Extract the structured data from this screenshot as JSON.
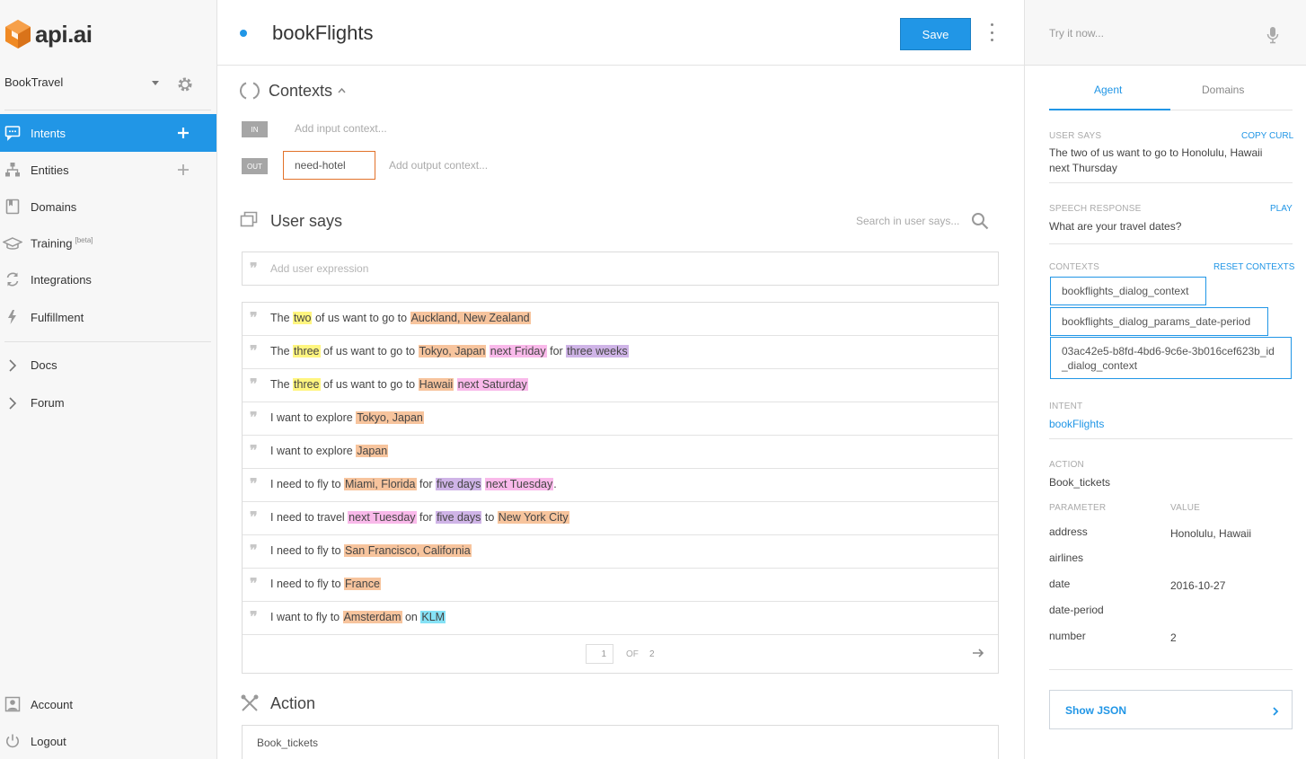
{
  "logo": {
    "text": "api.ai",
    "icon": "cube-logo-icon",
    "color": "#f08a24"
  },
  "agent": {
    "name": "BookTravel"
  },
  "sidebar": {
    "items": [
      {
        "label": "Intents",
        "icon": "chat-icon",
        "active": true,
        "plus": true
      },
      {
        "label": "Entities",
        "icon": "hierarchy-icon",
        "plus": true
      },
      {
        "label": "Domains",
        "icon": "book-icon"
      },
      {
        "label": "Training",
        "sup": "[beta]",
        "icon": "graduation-cap-icon"
      },
      {
        "label": "Integrations",
        "icon": "refresh-icon"
      },
      {
        "label": "Fulfillment",
        "icon": "lightning-icon"
      },
      {
        "label": "Docs",
        "icon": "chevron-right-icon"
      },
      {
        "label": "Forum",
        "icon": "chevron-right-icon"
      }
    ],
    "bottom": [
      {
        "label": "Account",
        "icon": "account-icon"
      },
      {
        "label": "Logout",
        "icon": "power-icon"
      }
    ]
  },
  "intent": {
    "title": "bookFlights",
    "save_label": "Save"
  },
  "contexts": {
    "title": "Contexts",
    "in_tag": "IN",
    "out_tag": "OUT",
    "input_placeholder": "Add input context...",
    "output_chip": "need-hotel",
    "output_placeholder": "Add output context..."
  },
  "user_says": {
    "title": "User says",
    "search_placeholder": "Search in user says...",
    "add_placeholder": "Add user expression",
    "examples": [
      [
        {
          "t": "The "
        },
        {
          "t": "two",
          "c": "num"
        },
        {
          "t": " of us want to go to "
        },
        {
          "t": "Auckland, New Zealand",
          "c": "geo"
        }
      ],
      [
        {
          "t": "The "
        },
        {
          "t": "three",
          "c": "num"
        },
        {
          "t": " of us want to go to "
        },
        {
          "t": "Tokyo, Japan",
          "c": "geo"
        },
        {
          "t": " "
        },
        {
          "t": "next Friday",
          "c": "date"
        },
        {
          "t": " for "
        },
        {
          "t": "three weeks",
          "c": "dur"
        }
      ],
      [
        {
          "t": "The "
        },
        {
          "t": "three",
          "c": "num"
        },
        {
          "t": " of us want to go to "
        },
        {
          "t": "Hawaii",
          "c": "geo"
        },
        {
          "t": " "
        },
        {
          "t": "next Saturday",
          "c": "date"
        }
      ],
      [
        {
          "t": "I want to explore "
        },
        {
          "t": "Tokyo, Japan",
          "c": "geo"
        }
      ],
      [
        {
          "t": "I want to explore "
        },
        {
          "t": "Japan",
          "c": "geo"
        }
      ],
      [
        {
          "t": "I need to fly to "
        },
        {
          "t": "Miami, Florida",
          "c": "geo"
        },
        {
          "t": " for "
        },
        {
          "t": "five days",
          "c": "dur"
        },
        {
          "t": " "
        },
        {
          "t": "next Tuesday",
          "c": "date"
        },
        {
          "t": "."
        }
      ],
      [
        {
          "t": "I need to travel "
        },
        {
          "t": "next Tuesday",
          "c": "date"
        },
        {
          "t": " for "
        },
        {
          "t": "five days",
          "c": "dur"
        },
        {
          "t": " to "
        },
        {
          "t": "New York City",
          "c": "geo"
        }
      ],
      [
        {
          "t": "I need to fly to "
        },
        {
          "t": "San Francisco, California",
          "c": "geo"
        }
      ],
      [
        {
          "t": "I need to fly to "
        },
        {
          "t": "France",
          "c": "geo"
        }
      ],
      [
        {
          "t": "I want to fly to "
        },
        {
          "t": "Amsterdam",
          "c": "geo"
        },
        {
          "t": " on "
        },
        {
          "t": "KLM",
          "c": "air"
        }
      ]
    ],
    "pager": {
      "page": "1",
      "of": "OF",
      "total": "2"
    }
  },
  "action": {
    "title": "Action",
    "value": "Book_tickets"
  },
  "console": {
    "try_placeholder": "Try it now...",
    "tabs": [
      "Agent",
      "Domains"
    ],
    "user_says_label": "USER SAYS",
    "copy_curl": "COPY CURL",
    "user_says_value": "The two of us want to go to Honolulu, Hawaii next Thursday",
    "speech_label": "SPEECH RESPONSE",
    "play": "PLAY",
    "speech_value": "What are your travel dates?",
    "contexts_label": "CONTEXTS",
    "reset_contexts": "RESET CONTEXTS",
    "contexts": [
      "bookflights_dialog_context",
      "bookflights_dialog_params_date-period",
      "03ac42e5-b8fd-4bd6-9c6e-3b016cef623b_id_dialog_context"
    ],
    "intent_label": "INTENT",
    "intent_value": "bookFlights",
    "action_label": "ACTION",
    "action_value": "Book_tickets",
    "param_header": "PARAMETER",
    "value_header": "VALUE",
    "params": [
      {
        "name": "address",
        "value": "Honolulu, Hawaii"
      },
      {
        "name": "airlines",
        "value": ""
      },
      {
        "name": "date",
        "value": "2016-10-27"
      },
      {
        "name": "date-period",
        "value": ""
      },
      {
        "name": "number",
        "value": "2"
      }
    ],
    "show_json": "Show JSON"
  },
  "colors": {
    "accent": "#2196e6",
    "number": "#fff57f",
    "geo": "#f7c49d",
    "date": "#f9b9ea",
    "duration": "#cfb4e7",
    "airline": "#86e2f6"
  }
}
